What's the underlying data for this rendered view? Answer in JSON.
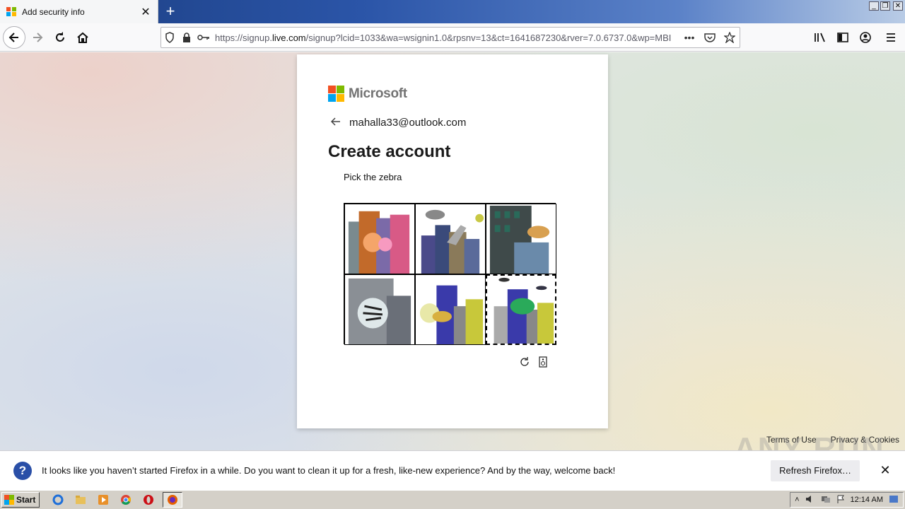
{
  "browser": {
    "tab_title": "Add security info",
    "tab_close": "✕",
    "new_tab": "+",
    "url_domain_prefix": "https://signup.",
    "url_domain": "live.com",
    "url_rest": "/signup?lcid=1033&wa=wsignin1.0&rpsnv=13&ct=1641687230&rver=7.0.6737.0&wp=MBI",
    "url_more": "•••",
    "window_controls": [
      "_",
      "❐",
      "✕"
    ]
  },
  "page": {
    "brand": "Microsoft",
    "identity_email": "mahalla33@outlook.com",
    "title": "Create account",
    "captcha_prompt": "Pick the zebra",
    "captcha_cells": [
      {
        "label": "cell-1"
      },
      {
        "label": "cell-2"
      },
      {
        "label": "cell-3"
      },
      {
        "label": "cell-4"
      },
      {
        "label": "cell-5"
      },
      {
        "label": "cell-6"
      }
    ],
    "footer": {
      "terms": "Terms of Use",
      "privacy": "Privacy & Cookies"
    }
  },
  "notification": {
    "message": "It looks like you haven’t started Firefox in a while. Do you want to clean it up for a fresh, like-new experience? And by the way, welcome back!",
    "button": "Refresh Firefox…",
    "close": "✕"
  },
  "watermark": "ANY RUN",
  "taskbar": {
    "start_label": "Start",
    "clock": "12:14 AM"
  },
  "colors": {
    "ms_red": "#f25022",
    "ms_green": "#7fba00",
    "ms_blue": "#00a4ef",
    "ms_yellow": "#ffb900",
    "info_blue": "#2a4fa7"
  }
}
